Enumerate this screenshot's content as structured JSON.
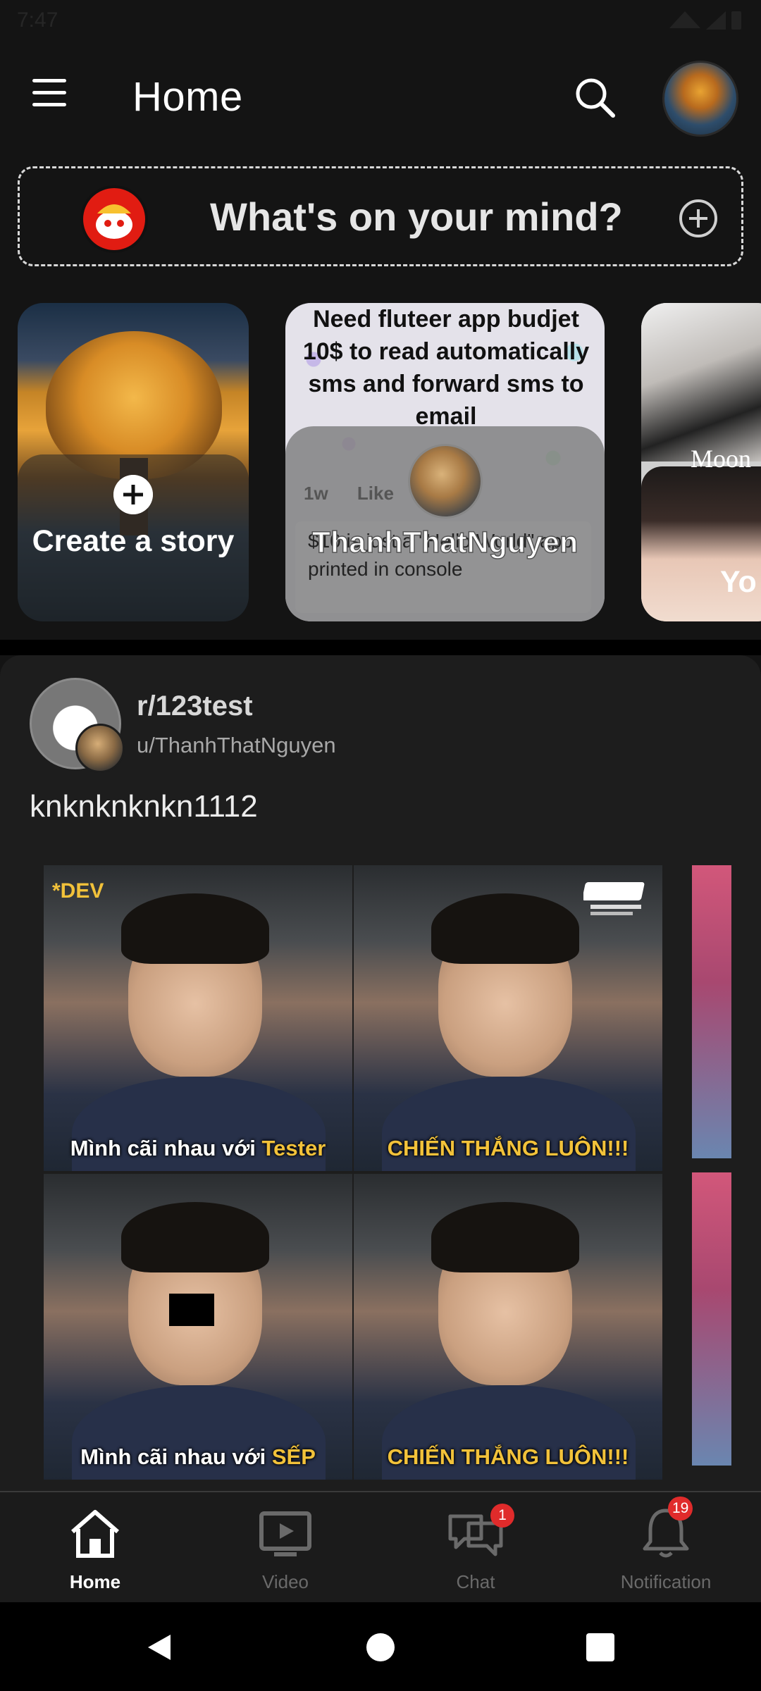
{
  "status_bar": {
    "time": "7:47"
  },
  "header": {
    "title": "Home"
  },
  "composer": {
    "placeholder": "What's on your mind?"
  },
  "stories": {
    "create": {
      "label": "Create a story"
    },
    "user_story": {
      "note": "Need fluteer app budjet 10$  to read automatically sms and forward sms to email",
      "time": "1w",
      "like": "Like",
      "quote": "$10 is just a \"Hello World\" app printed in console",
      "name": "ThanhThatNguyen"
    },
    "third_story": {
      "caption": "Moon",
      "name_partial": "Yo"
    }
  },
  "post": {
    "community": "r/123test",
    "author": "u/ThanhThatNguyen",
    "title": "knknknknkn1112",
    "media": {
      "dev_tag": "*DEV",
      "frames": [
        {
          "caption_prefix": "Mình cãi nhau với ",
          "caption_highlight": "Tester"
        },
        {
          "caption": "CHIẾN THẮNG LUÔN!!!"
        },
        {
          "caption_prefix": "Mình cãi nhau với ",
          "caption_highlight": "SẾP"
        },
        {
          "caption": "CHIẾN THẮNG LUÔN!!!"
        }
      ]
    }
  },
  "bottom_nav": {
    "items": [
      {
        "label": "Home",
        "icon": "home-icon",
        "active": true
      },
      {
        "label": "Video",
        "icon": "video-icon"
      },
      {
        "label": "Chat",
        "icon": "chat-icon",
        "badge": "1"
      },
      {
        "label": "Notification",
        "icon": "bell-icon",
        "badge": "19"
      }
    ]
  },
  "colors": {
    "background": "#141414",
    "card": "#1d1d1d",
    "accent_yellow": "#f2c23a",
    "badge_red": "#e02b2b"
  }
}
